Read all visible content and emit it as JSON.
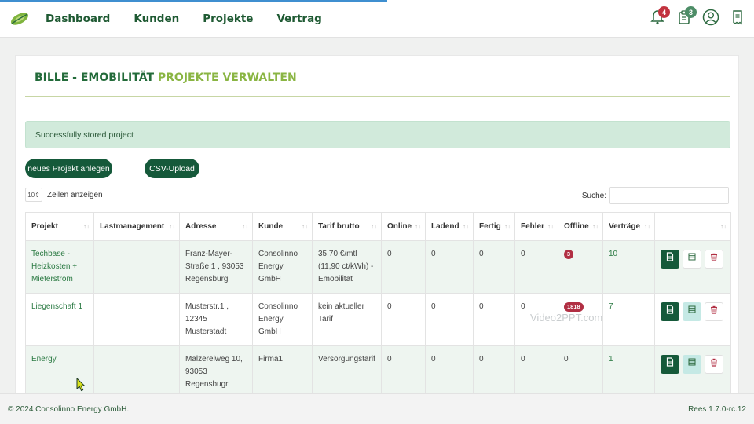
{
  "nav": {
    "links": [
      "Dashboard",
      "Kunden",
      "Projekte",
      "Vertrag"
    ],
    "badges": {
      "notifications": "4",
      "tasks": "3"
    }
  },
  "page": {
    "title_dark": "BILLE - EMOBILITÄT",
    "title_light": "PROJEKTE VERWALTEN",
    "alert": "Successfully stored project",
    "btn_new": "neues Projekt anlegen",
    "btn_csv": "CSV-Upload",
    "length_value": "10",
    "length_label": "Zeilen anzeigen",
    "search_label": "Suche:",
    "search_value": ""
  },
  "table": {
    "headers": [
      "Projekt",
      "Lastmanagement",
      "Adresse",
      "Kunde",
      "Tarif brutto",
      "Online",
      "Ladend",
      "Fertig",
      "Fehler",
      "Offline",
      "Verträge",
      ""
    ],
    "rows": [
      {
        "projekt": "Techbase - Heizkosten + Mieterstrom",
        "last": "",
        "adresse": "Franz-Mayer-Straße 1 , 93053 Regensburg",
        "kunde": "Consolinno Energy GmbH",
        "tarif": "35,70 €/mtl (11,90 ct/kWh) - Emobilität",
        "online": "0",
        "ladend": "0",
        "fertig": "0",
        "fehler": "0",
        "offline": "3",
        "vertraege": "10"
      },
      {
        "projekt": "Liegenschaft 1",
        "last": "",
        "adresse": "Musterstr.1 , 12345 Musterstadt",
        "kunde": "Consolinno Energy GmbH",
        "tarif": "kein aktueller Tarif",
        "online": "0",
        "ladend": "0",
        "fertig": "0",
        "fehler": "0",
        "offline": "1818",
        "vertraege": "7"
      },
      {
        "projekt": "Energy",
        "last": "",
        "adresse": "Mälzereiweg 10, 93053 Regensbugr",
        "kunde": "Firma1",
        "tarif": "Versorgungstarif",
        "online": "0",
        "ladend": "0",
        "fertig": "0",
        "fehler": "0",
        "offline": "0",
        "vertraege": "1"
      },
      {
        "projekt": "",
        "last": "",
        "adresse": "",
        "kunde": "",
        "tarif": "",
        "online": "",
        "ladend": "",
        "fertig": "",
        "fehler": "",
        "offline": "",
        "vertraege": ""
      }
    ]
  },
  "watermark": "Video2PPT.com",
  "footer": {
    "copyright": "© 2024 Consolinno Energy GmbH.",
    "version": "Rees 1.7.0-rc.12"
  },
  "colors": {
    "brand_dark": "#15593a",
    "brand_light": "#8ab543",
    "alert_bg": "#d1eadb",
    "badge_red": "#c2333f"
  },
  "icons": [
    "leaf-logo-icon",
    "bell-icon",
    "clipboard-icon",
    "user-circle-icon",
    "receipt-icon",
    "sort-icon",
    "document-icon",
    "list-icon",
    "trash-icon",
    "mouse-cursor-icon"
  ]
}
